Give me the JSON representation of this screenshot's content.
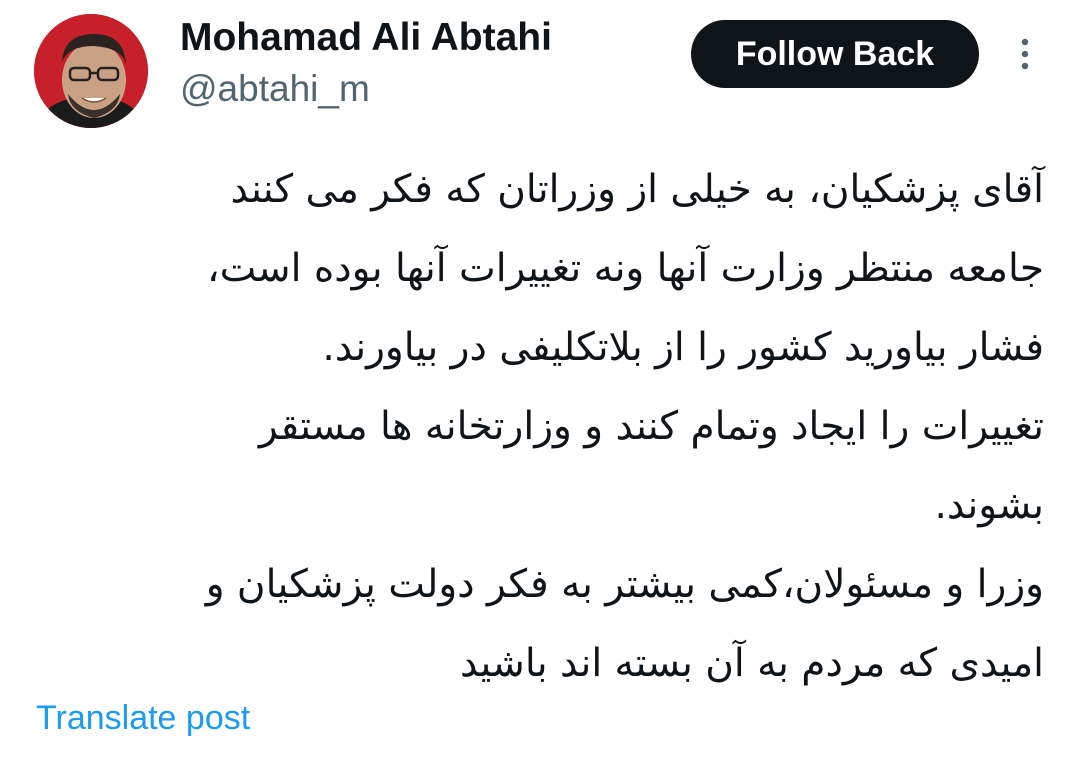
{
  "author": {
    "display_name": "Mohamad Ali Abtahi",
    "handle": "@abtahi_m"
  },
  "follow_button": {
    "label": "Follow Back"
  },
  "more_menu": {
    "icon": "more-vertical-icon"
  },
  "tweet": {
    "lines": [
      "آقای پزشکیان، به خیلی از وزراتان که فکر می کنند",
      "جامعه منتظر وزارت آنها ونه تغییرات آنها بوده است،",
      "فشار بیاورید کشور را از بلاتکلیفی در بیاورند.",
      "تغییرات را ایجاد وتمام کنند و وزارتخانه ها مستقر",
      "بشوند.",
      "وزرا و مسئولان،کمی بیشتر به فکر دولت پزشکیان و",
      "امیدی که مردم به آن بسته اند  باشید"
    ]
  },
  "translate_link": {
    "label": "Translate post"
  },
  "colors": {
    "text": "#0f1419",
    "secondary": "#536471",
    "link": "#1d9bf0",
    "button_bg": "#0f1419",
    "button_text": "#ffffff"
  }
}
